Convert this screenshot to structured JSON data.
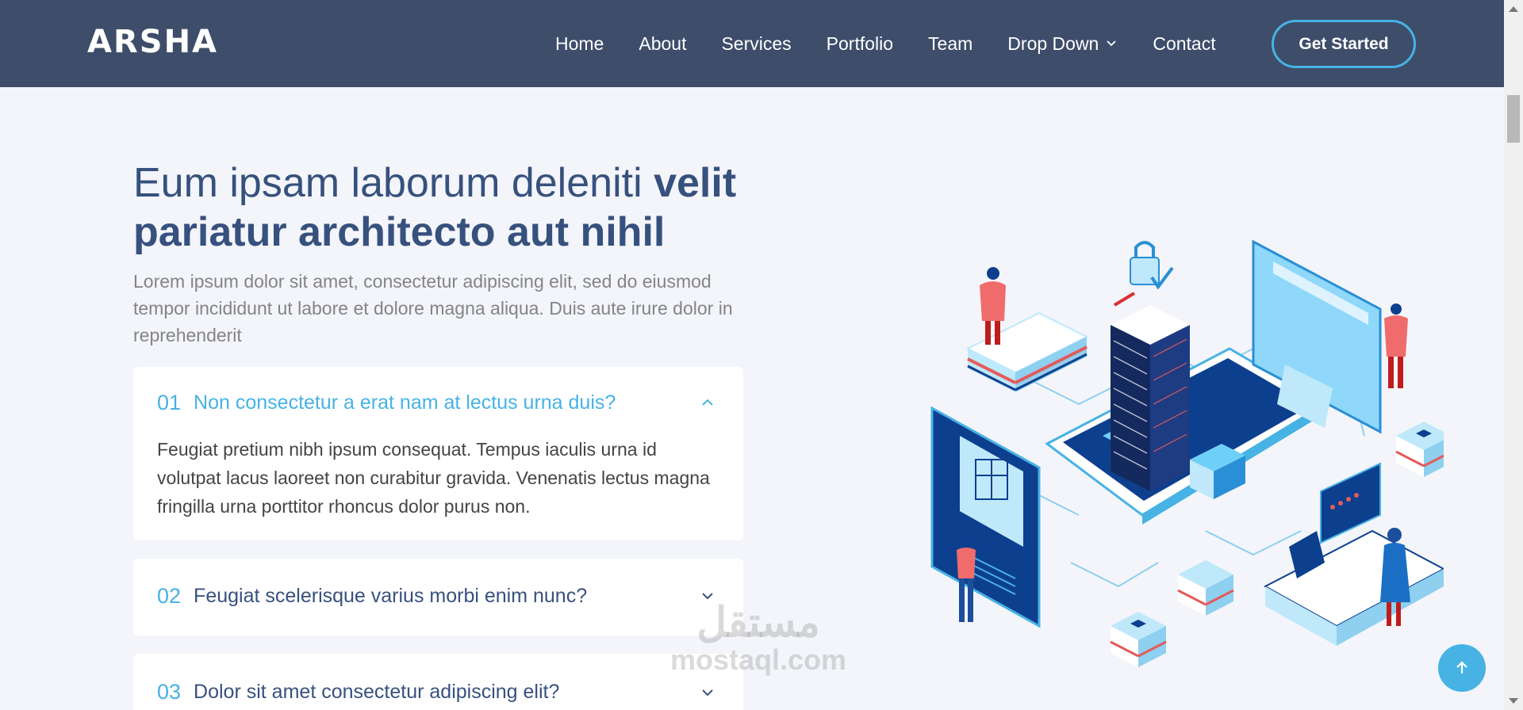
{
  "brand": {
    "logo": "ARSHA"
  },
  "nav": {
    "items": [
      "Home",
      "About",
      "Services",
      "Portfolio",
      "Team",
      "Drop Down",
      "Contact"
    ],
    "cta": "Get Started"
  },
  "hero": {
    "title_regular": "Eum ipsam laborum deleniti ",
    "title_bold": "velit pariatur architecto aut nihil",
    "subtitle": "Lorem ipsum dolor sit amet, consectetur adipiscing elit, sed do eiusmod tempor incididunt ut labore et dolore magna aliqua. Duis aute irure dolor in reprehenderit"
  },
  "faq": [
    {
      "num": "01",
      "question": "Non consectetur a erat nam at lectus urna duis?",
      "answer": "Feugiat pretium nibh ipsum consequat. Tempus iaculis urna id volutpat lacus laoreet non curabitur gravida. Venenatis lectus magna fringilla urna porttitor rhoncus dolor purus non.",
      "open": true
    },
    {
      "num": "02",
      "question": "Feugiat scelerisque varius morbi enim nunc?",
      "open": false
    },
    {
      "num": "03",
      "question": "Dolor sit amet consectetur adipiscing elit?",
      "open": false
    }
  ],
  "watermark": {
    "arabic": "مستقل",
    "latin": "mostaql.com"
  },
  "colors": {
    "header": "#3d4d6a",
    "accent": "#47b2e4",
    "heading": "#37517e"
  },
  "icons": {
    "dropdown": "chevron-down-icon",
    "faq_open": "chevron-up-icon",
    "faq_closed": "chevron-down-icon",
    "back_to_top": "arrow-up-icon"
  }
}
